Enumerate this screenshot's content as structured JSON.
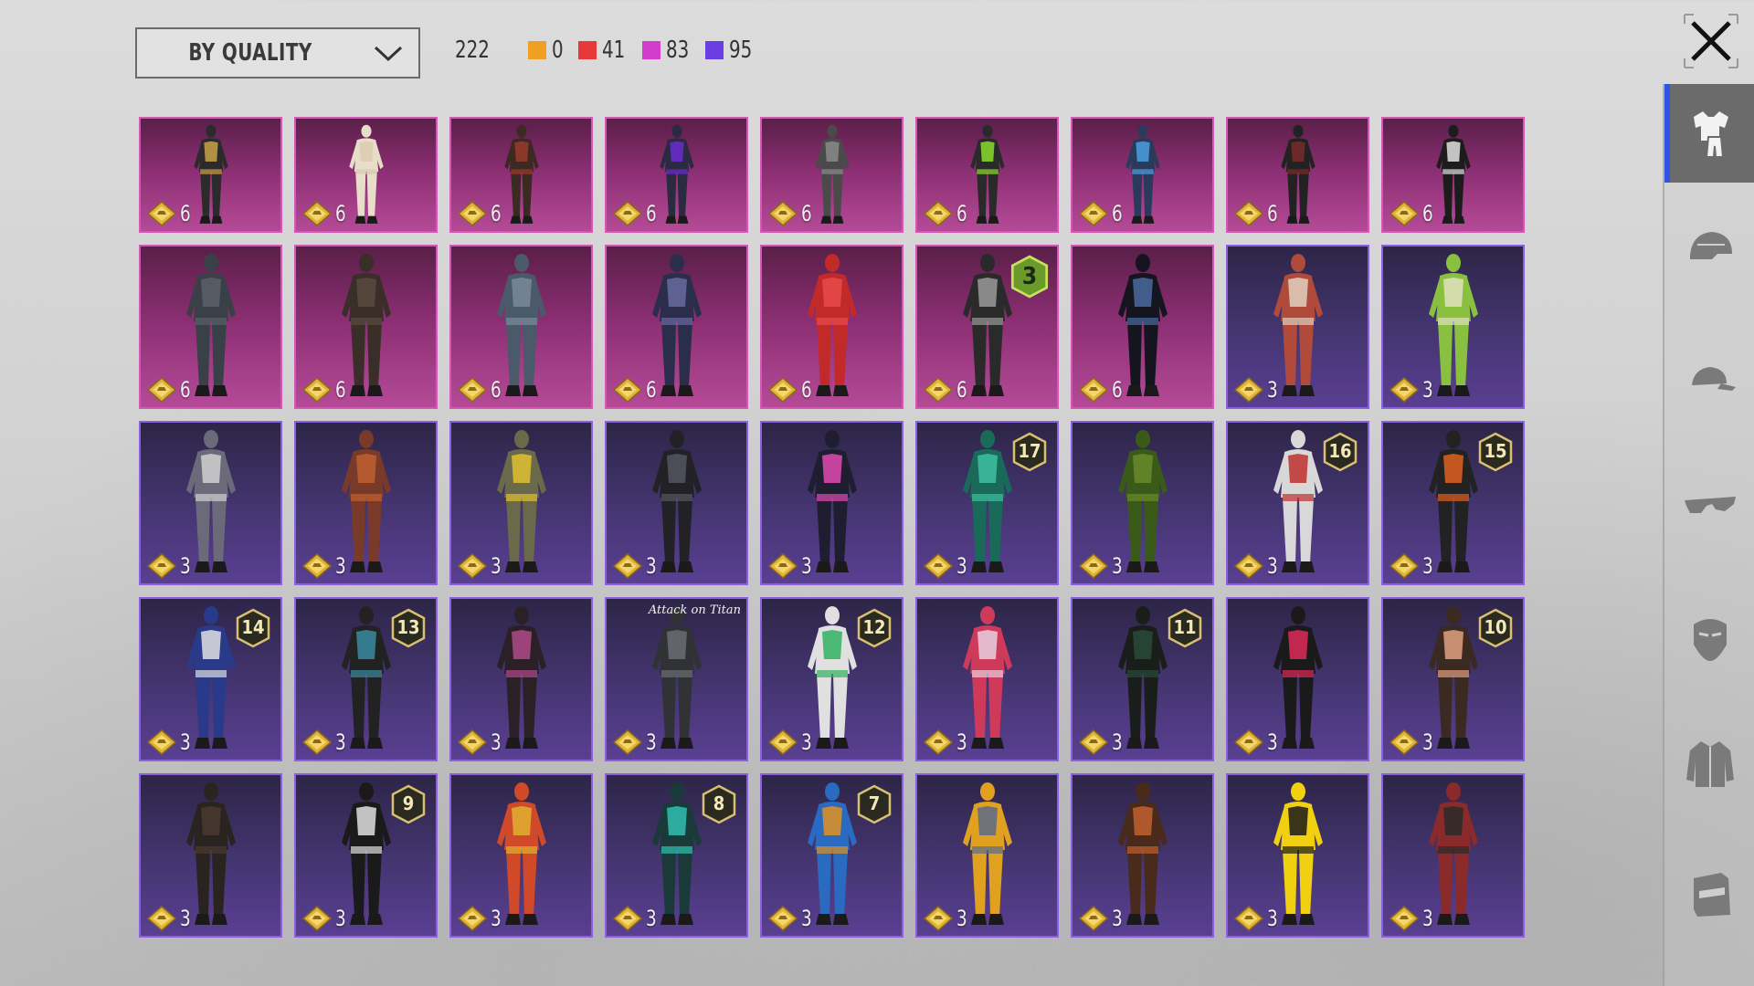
{
  "filter": {
    "sort_label": "BY QUALITY"
  },
  "counts": {
    "total": "222",
    "quality": [
      {
        "color": "#f0a020",
        "count": "0"
      },
      {
        "color": "#e8383a",
        "count": "41"
      },
      {
        "color": "#d43ccc",
        "count": "83"
      },
      {
        "color": "#6a3ee0",
        "count": "95"
      }
    ]
  },
  "colors": {
    "legendary_card": "#8a2e72",
    "epic_card": "#43346e",
    "active_tab_accent": "#2d55e6"
  },
  "sidebar": {
    "tabs": [
      {
        "name": "outfit-tab",
        "icon": "outfit-icon",
        "active": true
      },
      {
        "name": "helmet-tab",
        "icon": "helmet-icon",
        "active": false
      },
      {
        "name": "cap-tab",
        "icon": "cap-icon",
        "active": false
      },
      {
        "name": "glasses-tab",
        "icon": "glasses-icon",
        "active": false
      },
      {
        "name": "mask-tab",
        "icon": "mask-icon",
        "active": false
      },
      {
        "name": "jacket-tab",
        "icon": "jacket-icon",
        "active": false
      },
      {
        "name": "backpack-tab",
        "icon": "backpack-icon",
        "active": false
      }
    ]
  },
  "items": [
    {
      "quality": "legendary",
      "points": "6",
      "badge": "",
      "palette": [
        "#2b2b2b",
        "#c9a14a"
      ]
    },
    {
      "quality": "legendary",
      "points": "6",
      "badge": "",
      "palette": [
        "#e8ddc8",
        "#d9ccb0"
      ]
    },
    {
      "quality": "legendary",
      "points": "6",
      "badge": "",
      "palette": [
        "#3a2a22",
        "#9a3a2a"
      ]
    },
    {
      "quality": "legendary",
      "points": "6",
      "badge": "",
      "palette": [
        "#2a2a40",
        "#6a2ad0"
      ]
    },
    {
      "quality": "legendary",
      "points": "6",
      "badge": "",
      "palette": [
        "#4a4a4a",
        "#8a8a8a"
      ]
    },
    {
      "quality": "legendary",
      "points": "6",
      "badge": "",
      "palette": [
        "#2a2a2a",
        "#8adc2a"
      ]
    },
    {
      "quality": "legendary",
      "points": "6",
      "badge": "",
      "palette": [
        "#2a3a5a",
        "#4aa0e0"
      ]
    },
    {
      "quality": "legendary",
      "points": "6",
      "badge": "",
      "palette": [
        "#222222",
        "#7a2a2a"
      ]
    },
    {
      "quality": "legendary",
      "points": "6",
      "badge": "",
      "palette": [
        "#1c1c1c",
        "#e0e0e0"
      ]
    },
    {
      "quality": "legendary",
      "points": "6",
      "badge": "",
      "palette": [
        "#3a4048",
        "#5a6068"
      ]
    },
    {
      "quality": "legendary",
      "points": "6",
      "badge": "",
      "palette": [
        "#3a2e28",
        "#5a4a40"
      ]
    },
    {
      "quality": "legendary",
      "points": "6",
      "badge": "",
      "palette": [
        "#4a5a6a",
        "#7a8a9a"
      ]
    },
    {
      "quality": "legendary",
      "points": "6",
      "badge": "",
      "palette": [
        "#2a2e4a",
        "#6a6aa0"
      ]
    },
    {
      "quality": "legendary",
      "points": "6",
      "badge": "",
      "palette": [
        "#c22a2a",
        "#e84a4a"
      ]
    },
    {
      "quality": "legendary",
      "points": "6",
      "badge": "3",
      "palette": [
        "#2a2a2a",
        "#9a9a9a"
      ]
    },
    {
      "quality": "legendary",
      "points": "6",
      "badge": "",
      "palette": [
        "#15151f",
        "#4a6aa0"
      ]
    },
    {
      "quality": "epic",
      "points": "3",
      "badge": "",
      "palette": [
        "#b04a3a",
        "#e0d0c0"
      ]
    },
    {
      "quality": "epic",
      "points": "3",
      "badge": "",
      "palette": [
        "#8ac040",
        "#e0e0c0"
      ]
    },
    {
      "quality": "epic",
      "points": "3",
      "badge": "",
      "palette": [
        "#6a6a7a",
        "#d0d0d0"
      ]
    },
    {
      "quality": "epic",
      "points": "3",
      "badge": "",
      "palette": [
        "#7a3a2a",
        "#c06030"
      ]
    },
    {
      "quality": "epic",
      "points": "3",
      "badge": "",
      "palette": [
        "#6a6a4a",
        "#e0c030"
      ]
    },
    {
      "quality": "epic",
      "points": "3",
      "badge": "",
      "palette": [
        "#222226",
        "#555560"
      ]
    },
    {
      "quality": "epic",
      "points": "3",
      "badge": "",
      "palette": [
        "#1e1e30",
        "#e04ab0"
      ]
    },
    {
      "quality": "epic",
      "points": "3",
      "badge": "17",
      "palette": [
        "#1a6a5a",
        "#40c0a0"
      ]
    },
    {
      "quality": "epic",
      "points": "3",
      "badge": "",
      "palette": [
        "#3a5a1a",
        "#6a8a2a"
      ]
    },
    {
      "quality": "epic",
      "points": "3",
      "badge": "16",
      "palette": [
        "#d8d8d8",
        "#c03030"
      ]
    },
    {
      "quality": "epic",
      "points": "3",
      "badge": "15",
      "palette": [
        "#222222",
        "#e06020"
      ]
    },
    {
      "quality": "epic",
      "points": "3",
      "badge": "14",
      "palette": [
        "#2a3a8a",
        "#e0e0e0"
      ]
    },
    {
      "quality": "epic",
      "points": "3",
      "badge": "13",
      "palette": [
        "#222222",
        "#3a8aa0"
      ]
    },
    {
      "quality": "epic",
      "points": "3",
      "badge": "",
      "palette": [
        "#2a2026",
        "#b04a8a"
      ]
    },
    {
      "quality": "epic",
      "points": "3",
      "badge": "",
      "collab": "Attack on Titan",
      "palette": [
        "#303236",
        "#6a6e74"
      ]
    },
    {
      "quality": "epic",
      "points": "3",
      "badge": "12",
      "palette": [
        "#e0e0e0",
        "#30b060"
      ]
    },
    {
      "quality": "epic",
      "points": "3",
      "badge": "",
      "palette": [
        "#d03a5a",
        "#e8d0e0"
      ]
    },
    {
      "quality": "epic",
      "points": "3",
      "badge": "11",
      "palette": [
        "#1a1e1a",
        "#2a4a3a"
      ]
    },
    {
      "quality": "epic",
      "points": "3",
      "badge": "",
      "palette": [
        "#1a1a1a",
        "#e02a5a"
      ]
    },
    {
      "quality": "epic",
      "points": "3",
      "badge": "10",
      "palette": [
        "#3a2a22",
        "#e0a080"
      ]
    },
    {
      "quality": "epic",
      "points": "3",
      "badge": "",
      "palette": [
        "#2a2420",
        "#4a3a30"
      ]
    },
    {
      "quality": "epic",
      "points": "3",
      "badge": "9",
      "palette": [
        "#1a1a1a",
        "#e0e0e0"
      ]
    },
    {
      "quality": "epic",
      "points": "3",
      "badge": "",
      "palette": [
        "#d04a2a",
        "#e0b030"
      ]
    },
    {
      "quality": "epic",
      "points": "3",
      "badge": "8",
      "palette": [
        "#1a3a3a",
        "#30c0b0"
      ]
    },
    {
      "quality": "epic",
      "points": "3",
      "badge": "7",
      "palette": [
        "#2a6ac0",
        "#e09020"
      ]
    },
    {
      "quality": "epic",
      "points": "3",
      "badge": "",
      "palette": [
        "#e0a020",
        "#5a6a8a"
      ]
    },
    {
      "quality": "epic",
      "points": "3",
      "badge": "",
      "palette": [
        "#4a2a1a",
        "#c06030"
      ]
    },
    {
      "quality": "epic",
      "points": "3",
      "badge": "",
      "palette": [
        "#f0d010",
        "#1a1a1a"
      ]
    },
    {
      "quality": "epic",
      "points": "3",
      "badge": "",
      "palette": [
        "#8a2a2a",
        "#2a2a2a"
      ]
    }
  ]
}
